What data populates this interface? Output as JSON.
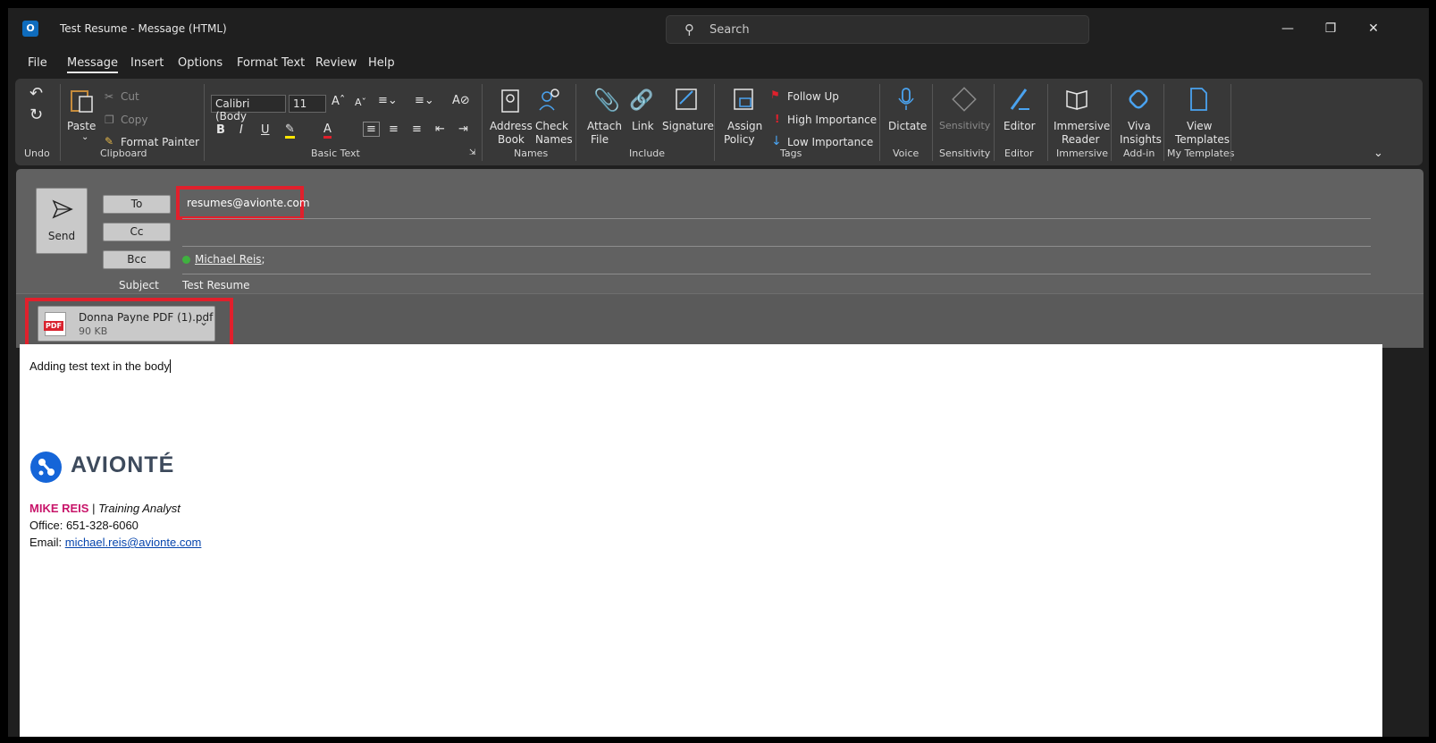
{
  "window": {
    "title": "Test Resume  -  Message (HTML)",
    "app_icon": "O",
    "search_placeholder": "Search",
    "controls": {
      "minimize": "—",
      "restore": "❐",
      "close": "✕"
    }
  },
  "menu": {
    "items": [
      "File",
      "Message",
      "Insert",
      "Options",
      "Format Text",
      "Review",
      "Help"
    ],
    "active": "Message"
  },
  "ribbon": {
    "groups": {
      "undo": "Undo",
      "clipboard": "Clipboard",
      "basic_text": "Basic Text",
      "names": "Names",
      "include": "Include",
      "tags": "Tags",
      "voice": "Voice",
      "sensitivity": "Sensitivity",
      "editor": "Editor",
      "immersive": "Immersive",
      "addin": "Add-in",
      "my_templates": "My Templates"
    },
    "clipboard": {
      "paste": "Paste",
      "cut": "Cut",
      "copy": "Copy",
      "format_painter": "Format Painter"
    },
    "font": {
      "family": "Calibri (Body",
      "size": "11"
    },
    "names": {
      "address_book": "Address\nBook",
      "address": "Address",
      "book": "Book",
      "check": "Check",
      "names": "Names"
    },
    "include": {
      "attach": "Attach",
      "file": "File",
      "link": "Link",
      "signature": "Signature"
    },
    "tags": {
      "assign": "Assign",
      "policy": "Policy",
      "follow_up": "Follow Up",
      "high": "High Importance",
      "low": "Low Importance"
    },
    "voice": {
      "dictate": "Dictate"
    },
    "sensitivity": {
      "label": "Sensitivity"
    },
    "editor": {
      "label": "Editor"
    },
    "immersive": {
      "line1": "Immersive",
      "line2": "Reader"
    },
    "addin": {
      "line1": "Viva",
      "line2": "Insights"
    },
    "templates": {
      "line1": "View",
      "line2": "Templates"
    },
    "colors": {
      "accent_icon": "#4aa3f0",
      "follow_flag": "#e0202c"
    }
  },
  "compose": {
    "send_label": "Send",
    "to_label": "To",
    "cc_label": "Cc",
    "bcc_label": "Bcc",
    "subject_label": "Subject",
    "to_value": "resumes@avionte.com",
    "bcc_value": "Michael Reis",
    "bcc_suffix": ";",
    "subject_value": "Test Resume",
    "attachment": {
      "name": "Donna Payne PDF (1).pdf",
      "size": "90 KB",
      "type_badge": "PDF"
    }
  },
  "body": {
    "text": "Adding test text in the body",
    "logo_text": "AVIONTÉ",
    "sig_name": "MIKE REIS",
    "sig_sep": " | ",
    "sig_title": "Training Analyst",
    "office": "Office: 651-328-6060",
    "email_label": "Email: ",
    "email": "michael.reis@avionte.com"
  }
}
